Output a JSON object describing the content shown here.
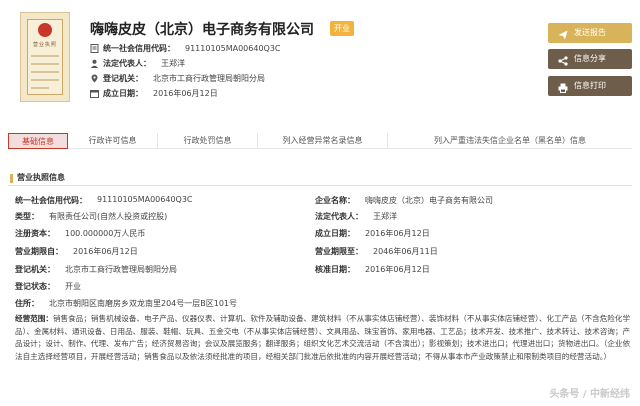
{
  "header": {
    "company_name": "嗨嗨皮皮（北京）电子商务有限公司",
    "status": "开业",
    "license_thumb_text": "营业执照",
    "credit_code_label": "统一社会信用代码：",
    "credit_code": "91110105MA00640Q3C",
    "legal_rep_label": "法定代表人：",
    "legal_rep": "王郑洋",
    "authority_label": "登记机关：",
    "authority": "北京市工商行政管理局朝阳分局",
    "established_label": "成立日期：",
    "established": "2016年06月12日"
  },
  "actions": {
    "report": "发送报告",
    "share": "信息分享",
    "print": "信息打印"
  },
  "tabs": [
    "基础信息",
    "行政许可信息",
    "行政处罚信息",
    "列入经营异常名录信息",
    "列入严重违法失信企业名单（黑名单）信息"
  ],
  "section": {
    "title": "营业执照信息"
  },
  "details": {
    "credit_code_k": "统一社会信用代码：",
    "credit_code_v": "91110105MA00640Q3C",
    "name_k": "企业名称：",
    "name_v": "嗨嗨皮皮（北京）电子商务有限公司",
    "type_k": "类型：",
    "type_v": "有限责任公司(自然人投资或控股)",
    "rep_k": "法定代表人：",
    "rep_v": "王郑洋",
    "capital_k": "注册资本：",
    "capital_v": "100.000000万人民币",
    "est_k": "成立日期：",
    "est_v": "2016年06月12日",
    "start_k": "营业期限自：",
    "start_v": "2016年06月12日",
    "end_k": "营业期限至：",
    "end_v": "2046年06月11日",
    "auth_k": "登记机关：",
    "auth_v": "北京市工商行政管理局朝阳分局",
    "approve_k": "核准日期：",
    "approve_v": "2016年06月12日",
    "state_k": "登记状态：",
    "state_v": "开业",
    "addr_k": "住所：",
    "addr_v": "北京市朝阳区南磨房乡双龙南里204号一层B区101号",
    "scope_k": "经营范围：",
    "scope_v": "销售食品；销售机械设备、电子产品、仪器仪表、计算机、软件及辅助设备、建筑材料（不从事实体店铺经营）、装饰材料（不从事实体店铺经营）、化工产品（不含危险化学品）、金属材料、通讯设备、日用品、服装、鞋帽、玩具、五金交电（不从事实体店铺经营）、文具用品、珠宝首饰、家用电器、工艺品；技术开发、技术推广、技术转让、技术咨询；产品设计；设计、制作、代理、发布广告；经济贸易咨询；会议及展览服务；翻译服务；组织文化艺术交流活动（不含演出）；影视策划；技术进出口；代理进出口；货物进出口。（企业依法自主选择经营项目，开展经营活动；销售食品以及依法须经批准的项目，经相关部门批准后依批准的内容开展经营活动；不得从事本市产业政策禁止和限制类项目的经营活动。）"
  },
  "watermark": "头条号 / 中新经纬",
  "colors": {
    "accent": "#d9b35a",
    "dark_button": "#6e5d4a",
    "active_tab": "#c0392b",
    "status_badge": "#f2b33d"
  }
}
